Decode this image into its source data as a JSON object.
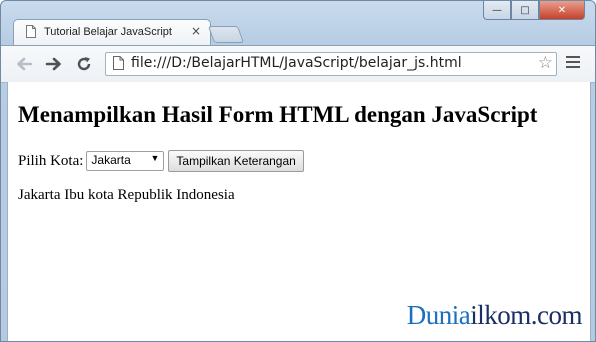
{
  "browser": {
    "tab_title": "Tutorial Belajar JavaScript",
    "tab_close": "×",
    "url": "file:///D:/BelajarHTML/JavaScript/belajar_js.html",
    "star": "☆",
    "window_buttons": {
      "minimize": "—",
      "maximize": "□",
      "close": "✕"
    }
  },
  "page": {
    "heading": "Menampilkan Hasil Form HTML dengan JavaScript",
    "form_label": "Pilih Kota:",
    "select_value": "Jakarta",
    "button_label": "Tampilkan Keterangan",
    "result_text": "Jakarta Ibu kota Republik Indonesia"
  },
  "watermark": {
    "part1": "Dunia",
    "part2": "ilkom.com"
  },
  "icons": [
    "page-icon",
    "close-icon",
    "back-arrow-icon",
    "forward-arrow-icon",
    "reload-icon",
    "star-icon",
    "menu-icon",
    "dropdown-arrow-icon"
  ]
}
